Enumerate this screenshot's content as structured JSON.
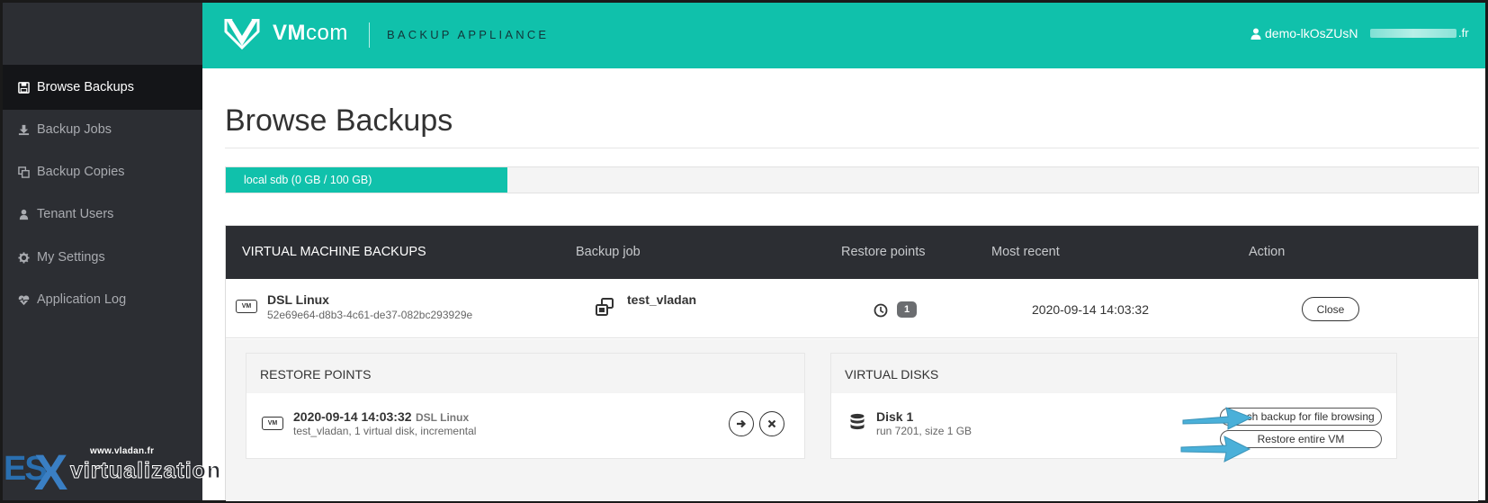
{
  "colors": {
    "accent": "#10c1ab",
    "sidebar": "#2c2e33",
    "sidebar_active": "#141518",
    "arrow": "#4ab0d9"
  },
  "header": {
    "logo": "VMcom",
    "logo_bold": "VM",
    "logo_light": "com",
    "product": "BACKUP APPLIANCE",
    "user": "demo-lkOsZUsN",
    "email_suffix": ".fr"
  },
  "sidebar": {
    "items": [
      {
        "label": "Browse Backups",
        "icon": "floppy-icon",
        "active": true
      },
      {
        "label": "Backup Jobs",
        "icon": "download-icon",
        "active": false
      },
      {
        "label": "Backup Copies",
        "icon": "copy-icon",
        "active": false
      },
      {
        "label": "Tenant Users",
        "icon": "user-icon",
        "active": false
      },
      {
        "label": "My Settings",
        "icon": "gear-icon",
        "active": false
      },
      {
        "label": "Application Log",
        "icon": "heartbeat-icon",
        "active": false
      }
    ]
  },
  "main": {
    "title": "Browse Backups",
    "storage": {
      "label": "local sdb (0 GB / 100 GB)",
      "fill_fraction": 0.225
    },
    "table": {
      "headers": [
        "VIRTUAL MACHINE BACKUPS",
        "Backup job",
        "Restore points",
        "Most recent",
        "Action"
      ],
      "row": {
        "vm_badge": "VM",
        "vm_name": "DSL Linux",
        "vm_uuid": "52e69e64-d8b3-4c61-de37-082bc293929e",
        "job": "test_vladan",
        "restore_count": "1",
        "most_recent": "2020-09-14 14:03:32",
        "action": "Close"
      }
    },
    "restore_points": {
      "title": "RESTORE POINTS",
      "item": {
        "badge": "VM",
        "date": "2020-09-14 14:03:32",
        "vm": "DSL Linux",
        "desc": "test_vladan, 1 virtual disk, incremental"
      }
    },
    "virtual_disks": {
      "title": "VIRTUAL DISKS",
      "item": {
        "name": "Disk 1",
        "desc": "run 7201, size 1 GB",
        "attach_label": "Attach backup for file browsing",
        "restore_label": "Restore entire VM"
      }
    }
  },
  "watermark": {
    "url": "www.vladan.fr",
    "es": "ES",
    "x": "X",
    "virt": "virtualization"
  }
}
